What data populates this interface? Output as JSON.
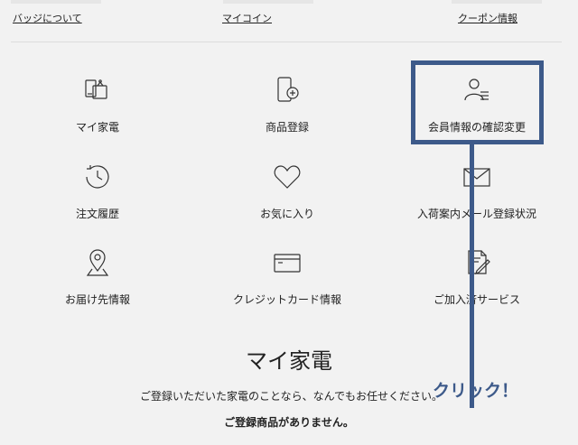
{
  "top_links": [
    {
      "label": "バッジについて"
    },
    {
      "label": "マイコイン"
    },
    {
      "label": "クーポン情報"
    }
  ],
  "menu": [
    {
      "label": "マイ家電",
      "icon": "appliance-icon"
    },
    {
      "label": "商品登録",
      "icon": "product-register-icon"
    },
    {
      "label": "会員情報の確認変更",
      "icon": "member-info-icon"
    },
    {
      "label": "注文履歴",
      "icon": "clock-icon"
    },
    {
      "label": "お気に入り",
      "icon": "heart-icon"
    },
    {
      "label": "入荷案内メール登録状況",
      "icon": "envelope-icon"
    },
    {
      "label": "お届け先情報",
      "icon": "location-pin-icon"
    },
    {
      "label": "クレジットカード情報",
      "icon": "credit-card-icon"
    },
    {
      "label": "ご加入済サービス",
      "icon": "service-document-icon"
    }
  ],
  "annotation": {
    "click_text": "クリック！",
    "color": "#3d5a8a"
  },
  "section": {
    "title": "マイ家電",
    "description": "ご登録いただいた家電のことなら、なんでもお任せください。",
    "empty_message": "ご登録商品がありません。"
  }
}
